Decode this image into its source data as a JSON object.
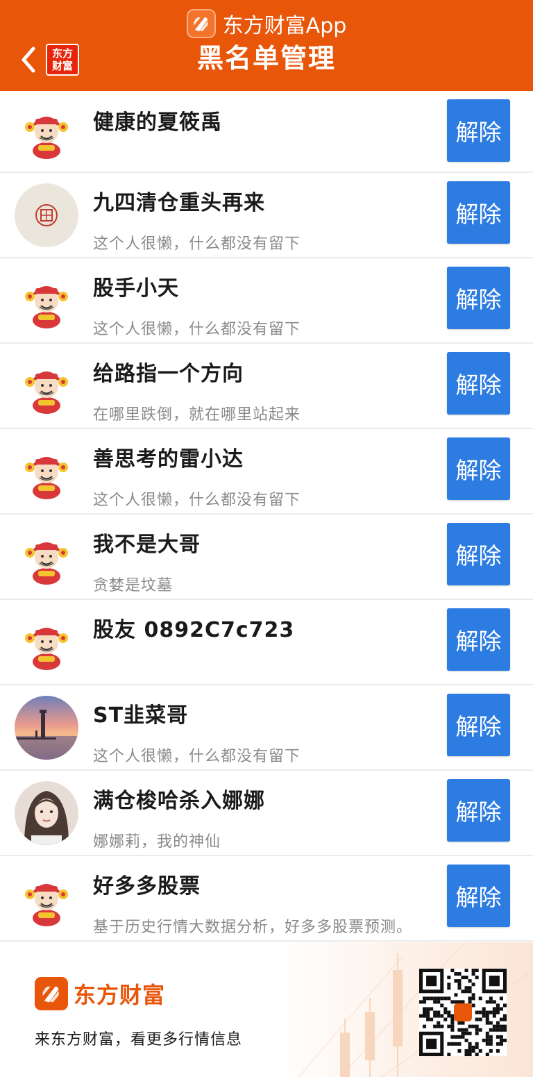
{
  "app": {
    "brand": "东方财富App",
    "small_logo_line1": "东方",
    "small_logo_line2": "财富",
    "accent": "#e8560a",
    "button_color": "#2d7ce1"
  },
  "header": {
    "title": "黑名单管理",
    "back_icon": "chevron-left-icon"
  },
  "blocked_users": [
    {
      "name": "健康的夏筱禹",
      "bio": "",
      "avatar": "caishen",
      "action": "解除"
    },
    {
      "name": "九四清仓重头再来",
      "bio": "这个人很懒，什么都没有留下",
      "avatar": "seal",
      "action": "解除"
    },
    {
      "name": "股手小天",
      "bio": "这个人很懒，什么都没有留下",
      "avatar": "caishen",
      "action": "解除"
    },
    {
      "name": "给路指一个方向",
      "bio": "在哪里跌倒，就在哪里站起来",
      "avatar": "caishen",
      "action": "解除"
    },
    {
      "name": "善思考的雷小达",
      "bio": "这个人很懒，什么都没有留下",
      "avatar": "caishen",
      "action": "解除"
    },
    {
      "name": "我不是大哥",
      "bio": "贪婪是坟墓",
      "avatar": "caishen",
      "action": "解除"
    },
    {
      "name": "股友 0892C7c723",
      "bio": "",
      "avatar": "caishen",
      "action": "解除"
    },
    {
      "name": "ST韭菜哥",
      "bio": "这个人很懒，什么都没有留下",
      "avatar": "sunset",
      "action": "解除"
    },
    {
      "name": "满仓梭哈杀入娜娜",
      "bio": "娜娜莉，我的神仙",
      "avatar": "portrait",
      "action": "解除"
    },
    {
      "name": "好多多股票",
      "bio": "基于历史行情大数据分析，好多多股票预测。",
      "avatar": "caishen",
      "action": "解除"
    }
  ],
  "footer": {
    "brand": "东方财富",
    "slogan": "来东方财富，看更多行情信息",
    "qr_icon": "qr-code-icon"
  }
}
